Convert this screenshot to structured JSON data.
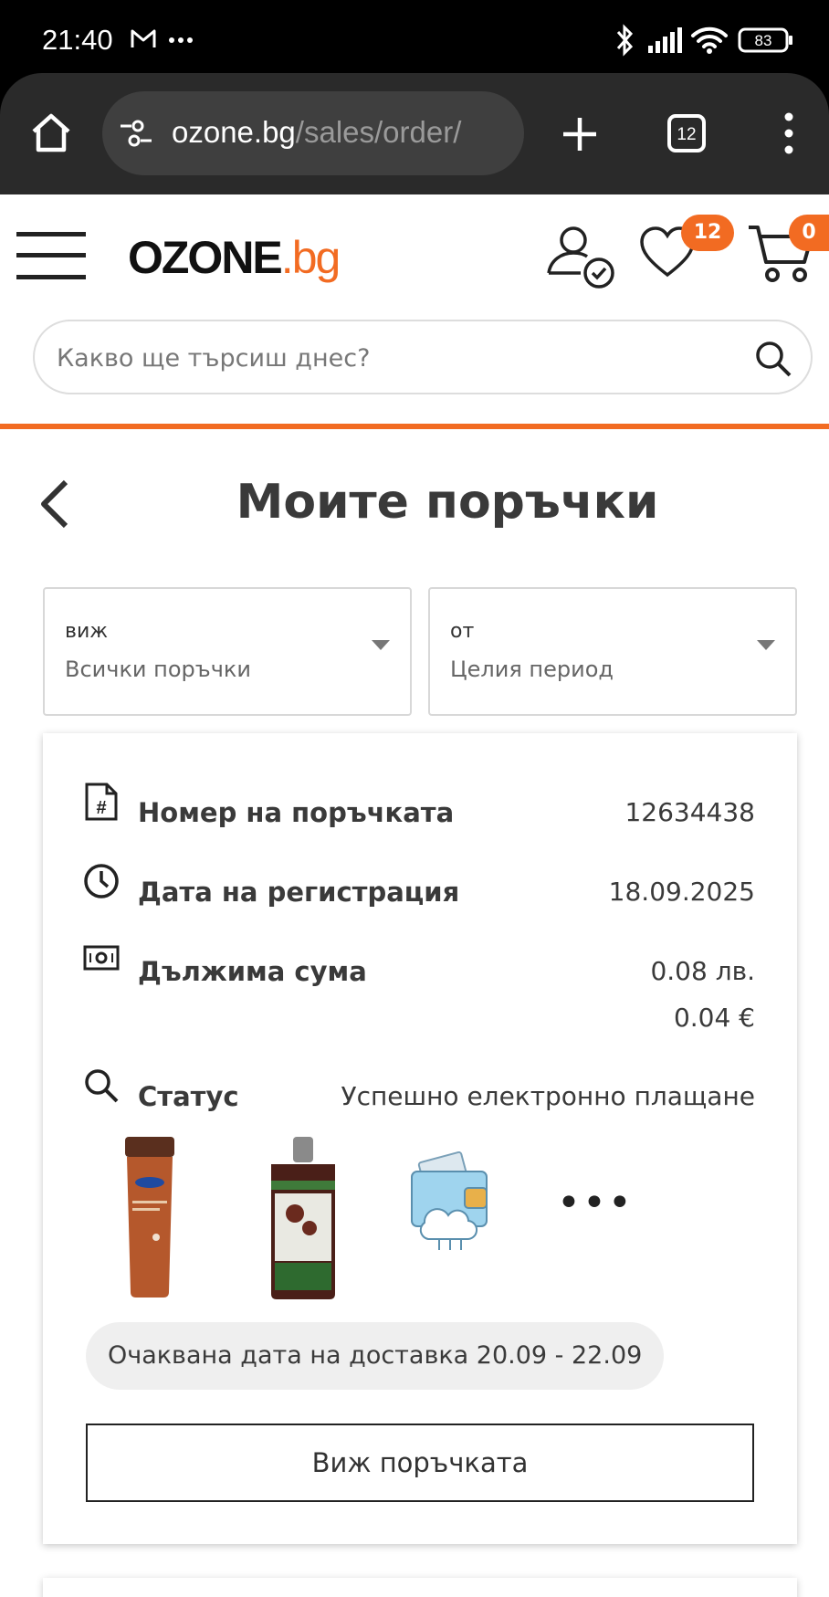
{
  "status_bar": {
    "time": "21:40",
    "battery": "83"
  },
  "browser": {
    "url_host": "ozone.bg",
    "url_path": "/sales/order/",
    "tab_count": "12"
  },
  "header": {
    "logo_main": "OZONE",
    "logo_domain": ".bg",
    "wishlist_count": "12",
    "cart_count": "0",
    "search_placeholder": "Какво ще търсиш днес?"
  },
  "page": {
    "title": "Моите поръчки"
  },
  "filters": [
    {
      "caption": "виж",
      "value": "Всички поръчки"
    },
    {
      "caption": "от",
      "value": "Целия период"
    }
  ],
  "order": {
    "number_label": "Номер на поръчката",
    "number_value": "12634438",
    "date_label": "Дата на регистрация",
    "date_value": "18.09.2025",
    "amount_label": "Дължима сума",
    "amount_bgn": "0.08 лв.",
    "amount_eur": "0.04 €",
    "status_label": "Статус",
    "status_value": "Успешно електронно плащане",
    "more_items": "•••",
    "delivery": "Очаквана дата на доставка 20.09 - 22.09",
    "view_button": "Виж поръчката"
  },
  "colors": {
    "brand_orange": "#f26b22"
  }
}
